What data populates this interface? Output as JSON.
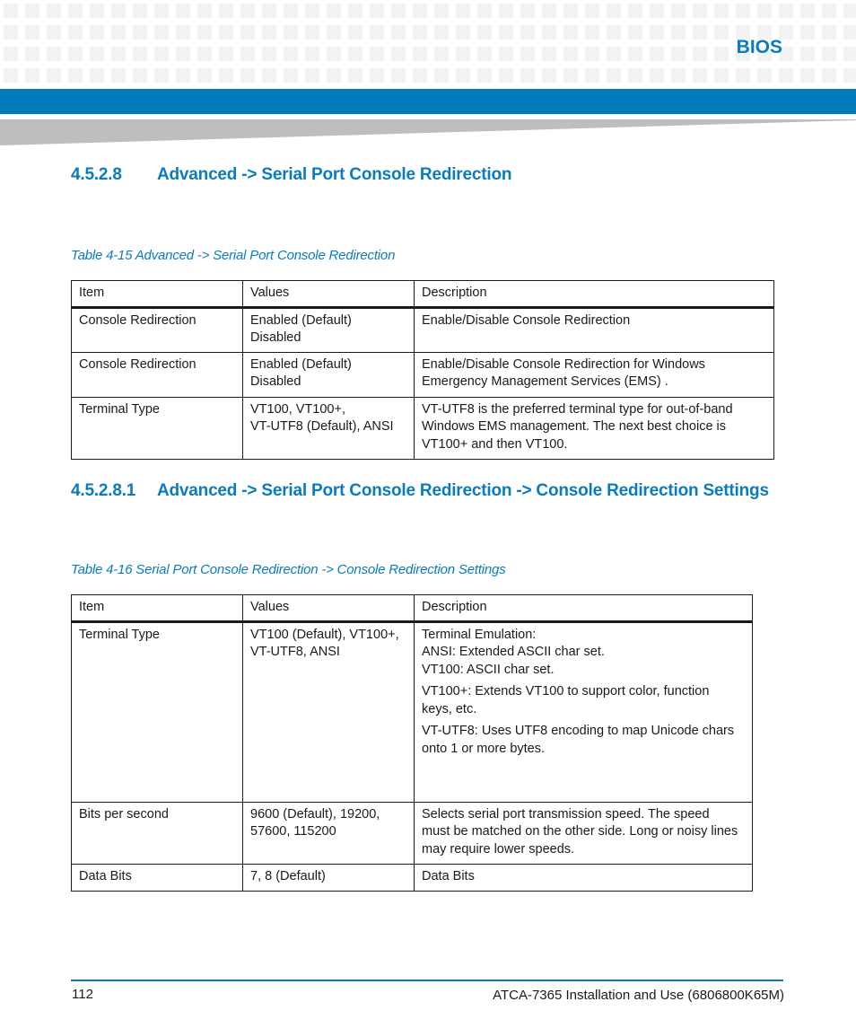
{
  "header": {
    "chapter_label": "BIOS",
    "colors": {
      "brand_blue": "#027bbd",
      "heading_blue": "#0a7bbd",
      "grid_gray": "#f3f3f3",
      "wedge_gray": "#bdbec0"
    }
  },
  "section1": {
    "number": "4.5.2.8",
    "title": "Advanced -> Serial Port Console Redirection",
    "caption": "Table 4-15 Advanced -> Serial Port Console Redirection",
    "table": {
      "headers": [
        "Item",
        "Values",
        "Description"
      ],
      "rows": [
        {
          "item": "Console Redirection",
          "values": [
            "Enabled (Default)",
            "Disabled"
          ],
          "description": [
            "Enable/Disable Console Redirection"
          ]
        },
        {
          "item": "Console Redirection",
          "values": [
            "Enabled (Default)",
            "Disabled"
          ],
          "description": [
            "Enable/Disable Console Redirection for Windows",
            "Emergency Management Services (EMS) ."
          ]
        },
        {
          "item": "Terminal Type",
          "values": [
            "VT100, VT100+,",
            "VT-UTF8 (Default), ANSI"
          ],
          "description": [
            "VT-UTF8 is the preferred terminal type for out-of-band",
            "Windows EMS management. The next best choice is",
            "VT100+ and then VT100."
          ]
        }
      ]
    }
  },
  "section2": {
    "number": "4.5.2.8.1",
    "title": "Advanced -> Serial Port Console Redirection -> Console Redirection Settings",
    "caption": "Table 4-16 Serial Port Console Redirection -> Console Redirection Settings",
    "table": {
      "headers": [
        "Item",
        "Values",
        "Description"
      ],
      "rows": [
        {
          "item": "Terminal Type",
          "values": [
            "VT100 (Default), VT100+,",
            "VT-UTF8, ANSI"
          ],
          "description_paragraphs": [
            [
              "Terminal Emulation:",
              "ANSI: Extended ASCII char set.",
              "VT100: ASCII char set."
            ],
            [
              "VT100+: Extends VT100 to support color, function",
              "keys, etc."
            ],
            [
              "VT-UTF8: Uses UTF8 encoding to map Unicode chars",
              "onto 1 or more bytes."
            ]
          ]
        },
        {
          "item": "Bits per second",
          "values": [
            "9600 (Default), 19200,",
            "57600, 115200"
          ],
          "description_paragraphs": [
            [
              "Selects serial port transmission speed. The speed",
              "must be matched on the other side. Long or noisy lines",
              "may require lower speeds."
            ]
          ]
        },
        {
          "item": "Data Bits",
          "values": [
            "7, 8 (Default)"
          ],
          "description_paragraphs": [
            [
              "Data Bits"
            ]
          ]
        }
      ]
    }
  },
  "footer": {
    "page_number": "112",
    "document_title": "ATCA-7365 Installation and Use (6806800K65M)"
  }
}
